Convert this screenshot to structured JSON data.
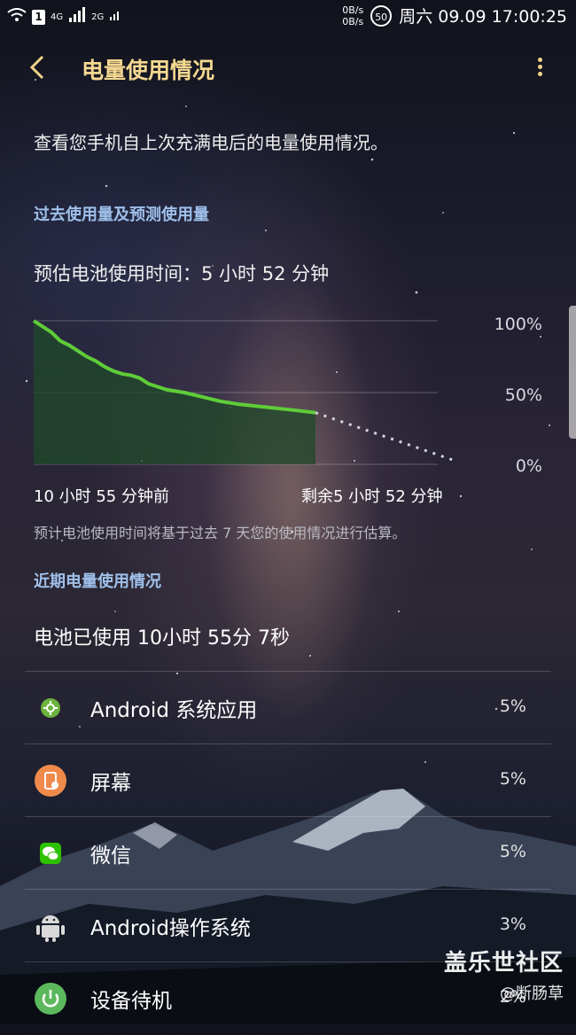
{
  "status_bar": {
    "network_badge": "4G",
    "net2": "2G",
    "sim": "1",
    "speed_up": "0B/s",
    "speed_down": "0B/s",
    "battery": "50",
    "datetime": "周六 09.09 17:00:25"
  },
  "header": {
    "title": "电量使用情况",
    "back_icon": "chevron-left-icon",
    "menu_icon": "more-vert-icon"
  },
  "description": "查看您手机自上次充满电后的电量使用情况。",
  "chart_section": {
    "heading": "过去使用量及预测使用量",
    "estimate": "预估电池使用时间：5 小时 52 分钟",
    "y_tick_100": "100%",
    "y_tick_50": "50%",
    "y_tick_0": "0%",
    "x_label_left": "10 小时 55 分钟前",
    "x_label_right": "剩余5 小时 52 分钟",
    "note": "预计电池使用时间将基于过去 7 天您的使用情况进行估算。"
  },
  "chart_data": {
    "type": "line",
    "ylim": [
      0,
      100
    ],
    "y_ticks": [
      "100%",
      "50%",
      "0%"
    ],
    "series": [
      {
        "values": [
          [
            0,
            100
          ],
          [
            10,
            96
          ],
          [
            20,
            92
          ],
          [
            30,
            86
          ],
          [
            40,
            83
          ],
          [
            50,
            79
          ],
          [
            60,
            75
          ],
          [
            70,
            72
          ],
          [
            80,
            68
          ],
          [
            90,
            65
          ],
          [
            100,
            63
          ],
          [
            110,
            62
          ],
          [
            120,
            60
          ],
          [
            130,
            56
          ],
          [
            150,
            52
          ],
          [
            170,
            50
          ],
          [
            190,
            47
          ],
          [
            210,
            44
          ],
          [
            230,
            42
          ],
          [
            260,
            40
          ],
          [
            290,
            38
          ],
          [
            318,
            36
          ]
        ]
      },
      {
        "dashed": true,
        "values": [
          [
            318,
            36
          ],
          [
            478,
            2
          ]
        ]
      }
    ]
  },
  "recent_section": {
    "heading": "近期电量使用情况",
    "used": "电池已使用 10小时 55分 7秒"
  },
  "apps": [
    {
      "name": "Android 系统应用",
      "percent": "5%",
      "icon": "android-system-gear-icon"
    },
    {
      "name": "屏幕",
      "percent": "5%",
      "icon": "screen-brightness-icon"
    },
    {
      "name": "微信",
      "percent": "5%",
      "icon": "wechat-icon"
    },
    {
      "name": "Android操作系统",
      "percent": "3%",
      "icon": "android-robot-icon"
    },
    {
      "name": "设备待机",
      "percent": "2%",
      "icon": "power-standby-icon"
    }
  ],
  "watermark": {
    "line1": "盖乐世社区",
    "line2": "@断肠草"
  },
  "colors": {
    "accent_title": "#f4d891",
    "section": "#9fc0ea",
    "line": "#5fcd38",
    "fill": "#1f4a2a"
  }
}
